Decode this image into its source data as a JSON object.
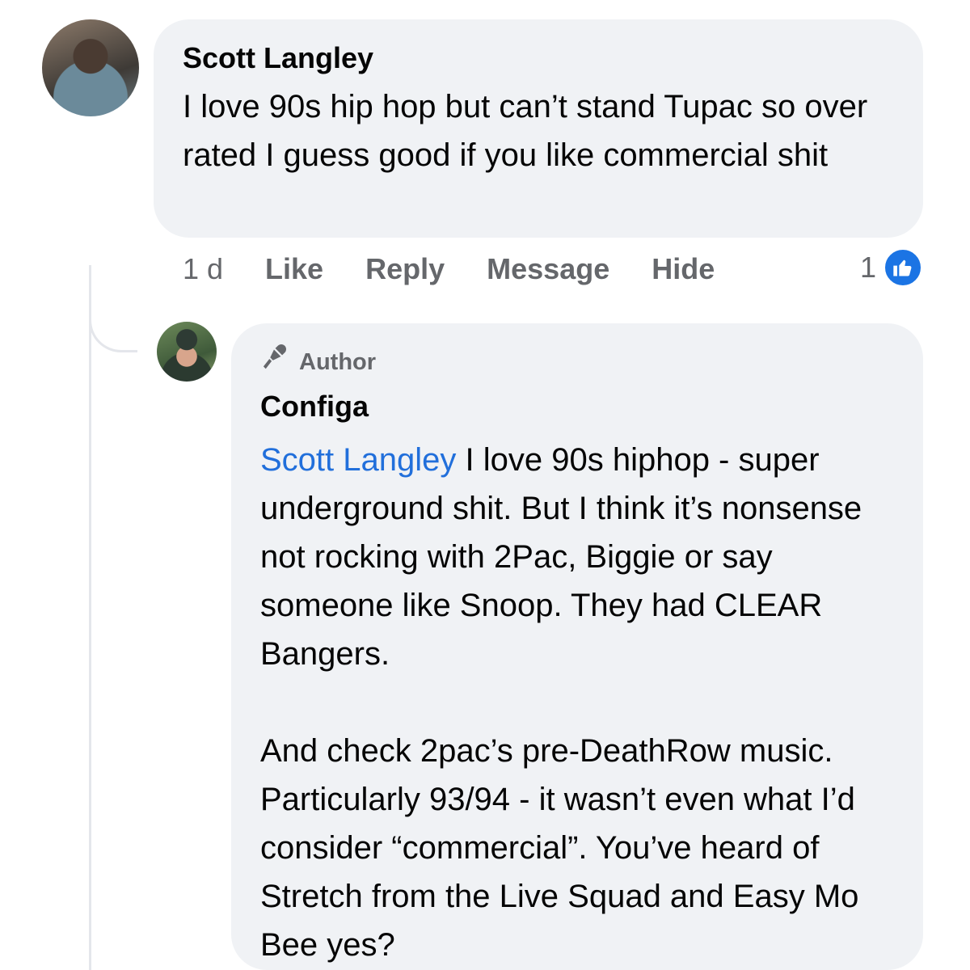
{
  "comment": {
    "author": "Scott Langley",
    "text": "I love 90s hip hop but can’t stand Tupac so over rated I guess good if you like commercial shit",
    "time": "1 d",
    "actions": {
      "like": "Like",
      "reply": "Reply",
      "message": "Message",
      "hide": "Hide"
    },
    "reaction_count": "1",
    "reaction_icon": "thumbs-up-icon",
    "colors": {
      "bubble": "#f0f2f5",
      "action_text": "#65676b",
      "like_badge": "#1b74e4"
    }
  },
  "reply": {
    "badge_label": "Author",
    "badge_icon": "microphone-icon",
    "author": "Configa",
    "mention": "Scott Langley",
    "mention_color": "#216fdb",
    "paragraph1_after_mention": " I love 90s hiphop - super underground shit. But I think it’s nonsense not rocking with 2Pac, Biggie or say someone like Snoop. They had CLEAR Bangers.",
    "paragraph2": "And check 2pac’s pre-DeathRow music. Particularly 93/94 - it wasn’t even what I’d consider “commercial”. You’ve heard of Stretch from the Live Squad and Easy Mo Bee yes?"
  }
}
